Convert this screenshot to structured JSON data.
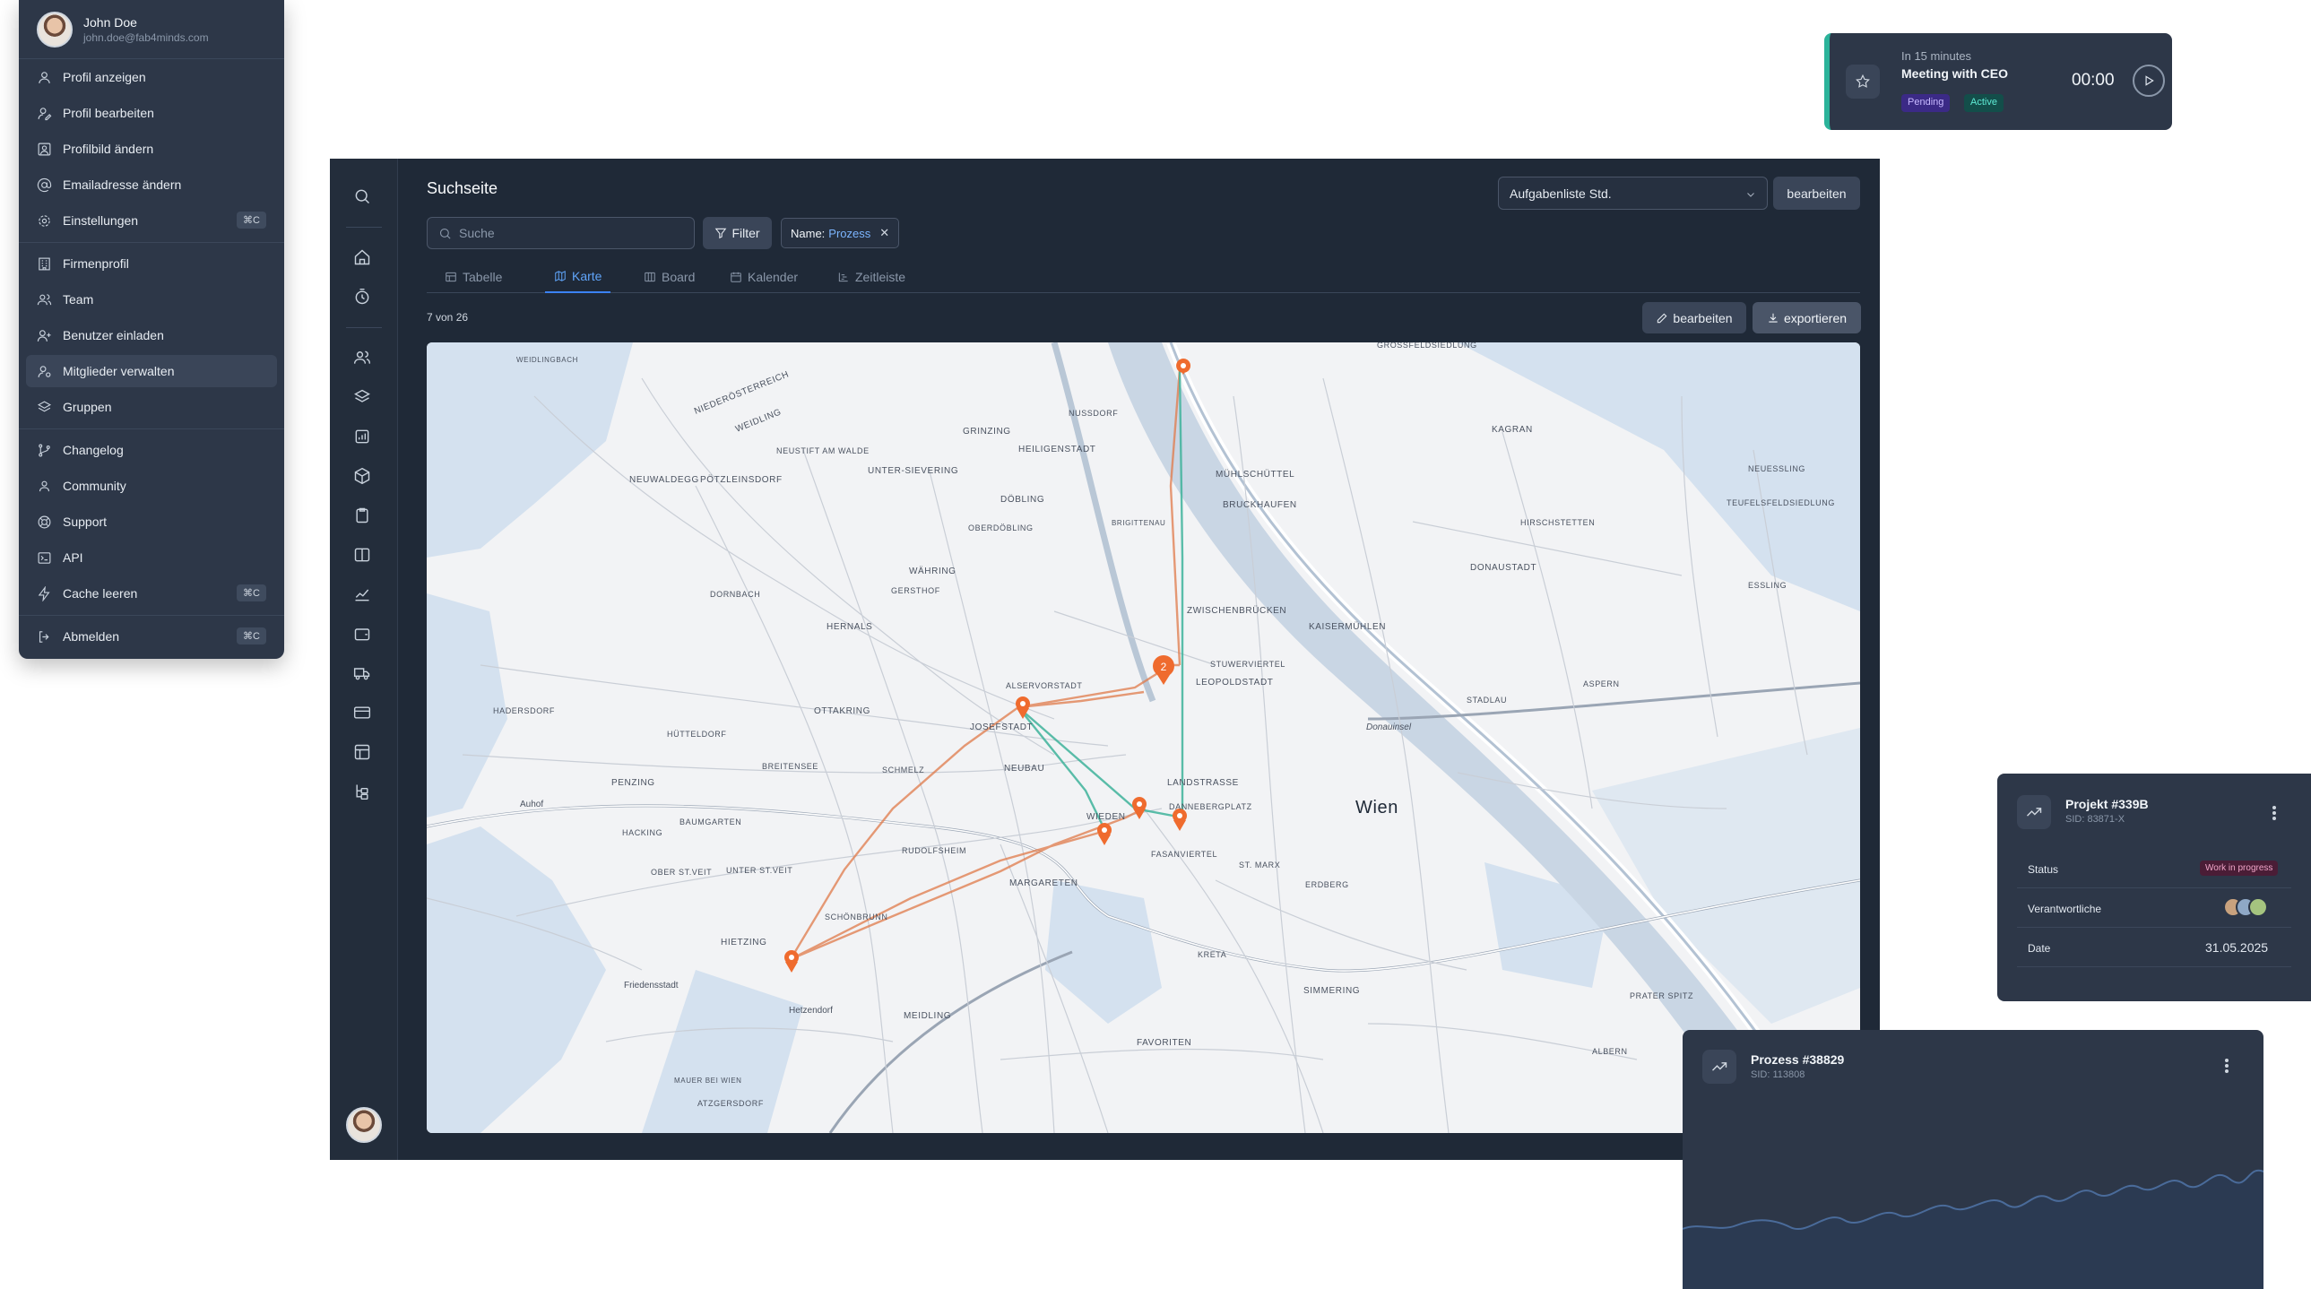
{
  "profile_menu": {
    "user_name": "John Doe",
    "user_email": "john.doe@fab4minds.com",
    "items": [
      {
        "label": "Profil anzeigen",
        "icon": "user-icon"
      },
      {
        "label": "Profil bearbeiten",
        "icon": "user-edit-icon"
      },
      {
        "label": "Profilbild ändern",
        "icon": "portrait-icon"
      },
      {
        "label": "Emailadresse ändern",
        "icon": "at-sign-icon"
      },
      {
        "label": "Einstellungen",
        "icon": "gear-icon",
        "shortcut": "⌘C"
      },
      {
        "label": "Firmenprofil",
        "icon": "building-icon"
      },
      {
        "label": "Team",
        "icon": "team-icon"
      },
      {
        "label": "Benutzer einladen",
        "icon": "user-plus-icon"
      },
      {
        "label": "Mitglieder verwalten",
        "icon": "user-manage-icon"
      },
      {
        "label": "Gruppen",
        "icon": "layers-icon"
      },
      {
        "label": "Changelog",
        "icon": "git-branch-icon"
      },
      {
        "label": "Community",
        "icon": "community-icon"
      },
      {
        "label": "Support",
        "icon": "lifebuoy-icon"
      },
      {
        "label": "API",
        "icon": "terminal-icon"
      },
      {
        "label": "Cache leeren",
        "icon": "bolt-icon",
        "shortcut": "⌘C"
      },
      {
        "label": "Abmelden",
        "icon": "logout-icon",
        "shortcut": "⌘C"
      }
    ]
  },
  "notification": {
    "when": "In 15 minutes",
    "title": "Meeting with CEO",
    "badge_pending": "Pending",
    "badge_active": "Active",
    "timer": "00:00",
    "accent": "#2bb39a"
  },
  "app": {
    "page_title": "Suchseite",
    "search_placeholder": "Suche",
    "filter_label": "Filter",
    "chip_key": "Name:",
    "chip_value": "Prozess",
    "list_select_value": "Aufgabenliste Std.",
    "edit_top_label": "bearbeiten",
    "tabs": [
      "Tabelle",
      "Karte",
      "Board",
      "Kalender",
      "Zeitleiste"
    ],
    "active_tab": "Karte",
    "result_count": "7 von 26",
    "edit_label": "bearbeiten",
    "export_label": "exportieren"
  },
  "map": {
    "city_label": "Wien",
    "district_labels": [
      "NIEDERÖSTERREICH",
      "WEIDLINGBACH",
      "WEIDLING",
      "NEUSTIFT AM WALDE",
      "GRINZING",
      "HEILIGENSTADT",
      "NUSSDORF",
      "UNTER-SIEVERING",
      "NEUWALDEGG",
      "PÖTZLEINSDORF",
      "DÖBLING",
      "OBERDÖBLING",
      "BRIGITTENAU",
      "MÜHLSCHÜTTEL",
      "BRUCKHAUFEN",
      "WÄHRING",
      "GERSTHOF",
      "DORNBACH",
      "HERNALS",
      "ZWISCHENBRÜCKEN",
      "KAISERMÜHLEN",
      "ALSERVORSTADT",
      "LEOPOLDSTADT",
      "STUWERVIERTEL",
      "OTTAKRING",
      "JOSEFSTADT",
      "NEUBAU",
      "HADERSDORF",
      "HÜTTELDORF",
      "BREITENSEE",
      "SCHMELZ",
      "PENZING",
      "LANDSTRASSE",
      "DANNEBERGPLATZ",
      "BAUMGARTEN",
      "HACKING",
      "RUDOLFSHEIM",
      "WIEDEN",
      "FASANVIERTEL",
      "OBER ST.VEIT",
      "UNTER ST.VEIT",
      "MARGARETEN",
      "ST. MARX",
      "ERDBERG",
      "HIETZING",
      "SCHÖNBRUNN",
      "FAVORITEN",
      "KRETA",
      "SIMMERING",
      "MEIDLING",
      "ALBERN",
      "ATZGERSDORF",
      "MAUER BEI WIEN",
      "DONAUSTADT",
      "KAGRAN",
      "HIRSCHSTETTEN",
      "ASPERN",
      "STADLAU",
      "ESSLING",
      "NEUESSLING",
      "TEUFELSFELDSIEDLUNG",
      "GROSSFELDSIEDLUNG",
      "PRATER SPITZ",
      "Friedensstadt",
      "Hetzendorf",
      "Auhof",
      "Donauinsel"
    ],
    "markers": [
      "1",
      "2",
      "3",
      "4",
      "5",
      "6",
      "7"
    ],
    "cluster_label": "2",
    "route_colors": {
      "orange": "#e07a4a",
      "teal": "#3fb39b"
    }
  },
  "project_card": {
    "title": "Projekt #339B",
    "sid": "SID: 83871-X",
    "status_label": "Status",
    "status_value": "Work in progress",
    "owners_label": "Verantwortliche",
    "date_label": "Date",
    "date_value": "31.05.2025"
  },
  "process_card": {
    "title": "Prozess #38829",
    "sid": "SID: 113808"
  }
}
